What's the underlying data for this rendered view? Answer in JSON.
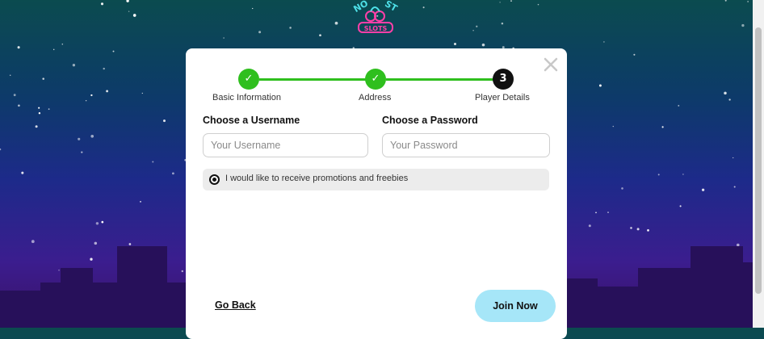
{
  "logo": {
    "text_top": "NO...ST",
    "badge": "SLOTS"
  },
  "modal": {
    "steps": [
      {
        "label": "Basic Information",
        "mark": "✓",
        "state": "done"
      },
      {
        "label": "Address",
        "mark": "✓",
        "state": "done"
      },
      {
        "label": "Player Details",
        "mark": "3",
        "state": "active"
      }
    ],
    "username": {
      "label": "Choose a Username",
      "placeholder": "Your Username",
      "value": ""
    },
    "password": {
      "label": "Choose a Password",
      "placeholder": "Your Password",
      "value": ""
    },
    "promotions": {
      "label": "I would like to receive promotions and freebies",
      "checked": true
    },
    "back_label": "Go Back",
    "join_label": "Join Now"
  },
  "colors": {
    "step_done": "#2fbf1e",
    "step_active": "#111111",
    "join_button": "#a6e6f8",
    "sky_top": "#0b4b4f",
    "sky_bottom": "#3a1066"
  }
}
